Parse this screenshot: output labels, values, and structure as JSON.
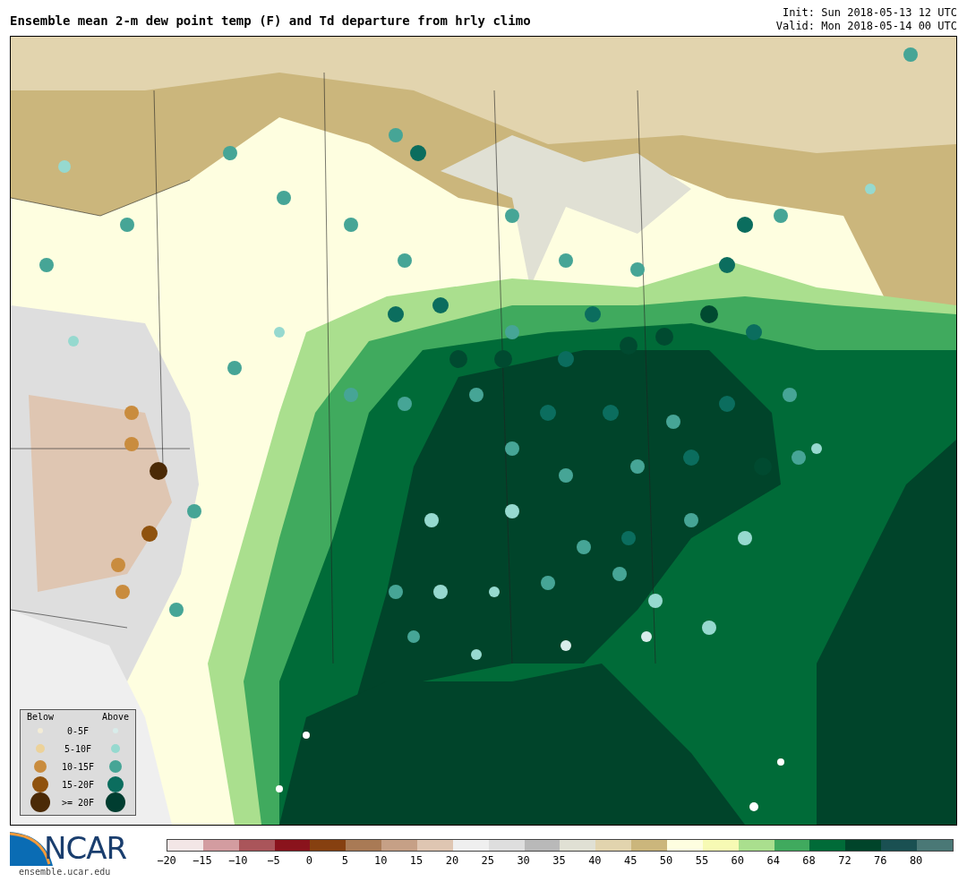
{
  "title": "Ensemble mean 2-m dew point temp (F) and Td departure from hrly climo",
  "init": "Init: Sun 2018-05-13 12 UTC",
  "valid": "Valid: Mon 2018-05-14 00 UTC",
  "legend": {
    "below_heading": "Below",
    "above_heading": "Above",
    "rows": [
      {
        "label": "0-5F",
        "below": {
          "color": "#f3ecd6"
        },
        "above": {
          "color": "#d8ecea"
        }
      },
      {
        "label": "5-10F",
        "below": {
          "color": "#ecd29a"
        },
        "above": {
          "color": "#96d9cf"
        }
      },
      {
        "label": "10-15F",
        "below": {
          "color": "#c98c3e"
        },
        "above": {
          "color": "#46a596"
        }
      },
      {
        "label": "15-20F",
        "below": {
          "color": "#8f520e"
        },
        "above": {
          "color": "#0b6d5e"
        }
      },
      {
        "label": ">= 20F",
        "below": {
          "color": "#4b2a06"
        },
        "above": {
          "color": "#003d30"
        }
      }
    ]
  },
  "logo": {
    "text": "NCAR",
    "url": "ensemble.ucar.edu"
  },
  "colorbar": {
    "bins": [
      {
        "color": "#f3e6e6"
      },
      {
        "color": "#d39ca0"
      },
      {
        "color": "#aa555a"
      },
      {
        "color": "#8a131c"
      },
      {
        "color": "#864010"
      },
      {
        "color": "#a97a55"
      },
      {
        "color": "#c6a086"
      },
      {
        "color": "#dfc6b2"
      },
      {
        "color": "#efefef"
      },
      {
        "color": "#dedede"
      },
      {
        "color": "#b9b9b9"
      },
      {
        "color": "#e0e0d4"
      },
      {
        "color": "#e2d4ae"
      },
      {
        "color": "#cbb67c"
      },
      {
        "color": "#fefee0"
      },
      {
        "color": "#f7fab4"
      },
      {
        "color": "#aadf8e"
      },
      {
        "color": "#40aa5e"
      },
      {
        "color": "#006b38"
      },
      {
        "color": "#00442a"
      },
      {
        "color": "#1a5052"
      },
      {
        "color": "#4a7876"
      }
    ],
    "ticks": [
      "−20",
      "−15",
      "−10",
      "−5",
      "0",
      "5",
      "10",
      "15",
      "20",
      "25",
      "30",
      "35",
      "40",
      "45",
      "50",
      "55",
      "60",
      "64",
      "68",
      "72",
      "76",
      "80"
    ]
  }
}
